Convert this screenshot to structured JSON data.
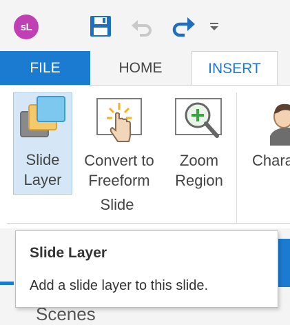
{
  "user": {
    "initials": "sL",
    "color": "#c040b4"
  },
  "quick_access": [
    {
      "name": "save",
      "icon": "save-icon"
    },
    {
      "name": "undo",
      "icon": "undo-icon"
    },
    {
      "name": "redo",
      "icon": "redo-icon"
    },
    {
      "name": "customize",
      "icon": "dropdown-arrow-icon"
    }
  ],
  "tabs": [
    {
      "label": "FILE"
    },
    {
      "label": "HOME"
    },
    {
      "label": "INSERT",
      "active": true
    }
  ],
  "ribbon": {
    "buttons": [
      {
        "line1": "Slide",
        "line2": "Layer",
        "icon": "slide-layer-icon",
        "selected": true
      },
      {
        "line1": "Convert to",
        "line2": "Freeform",
        "icon": "convert-freeform-icon"
      },
      {
        "line1": "Zoom",
        "line2": "Region",
        "icon": "zoom-region-icon"
      },
      {
        "line1": "Chara",
        "icon": "character-icon"
      }
    ],
    "group_label": "Slide"
  },
  "tooltip": {
    "title": "Slide Layer",
    "description": "Add a slide layer to this slide."
  },
  "panel": {
    "scenes_label": "Scenes"
  },
  "colors": {
    "accent": "#1a7bd0",
    "selected_bg": "#d5e6f6"
  }
}
